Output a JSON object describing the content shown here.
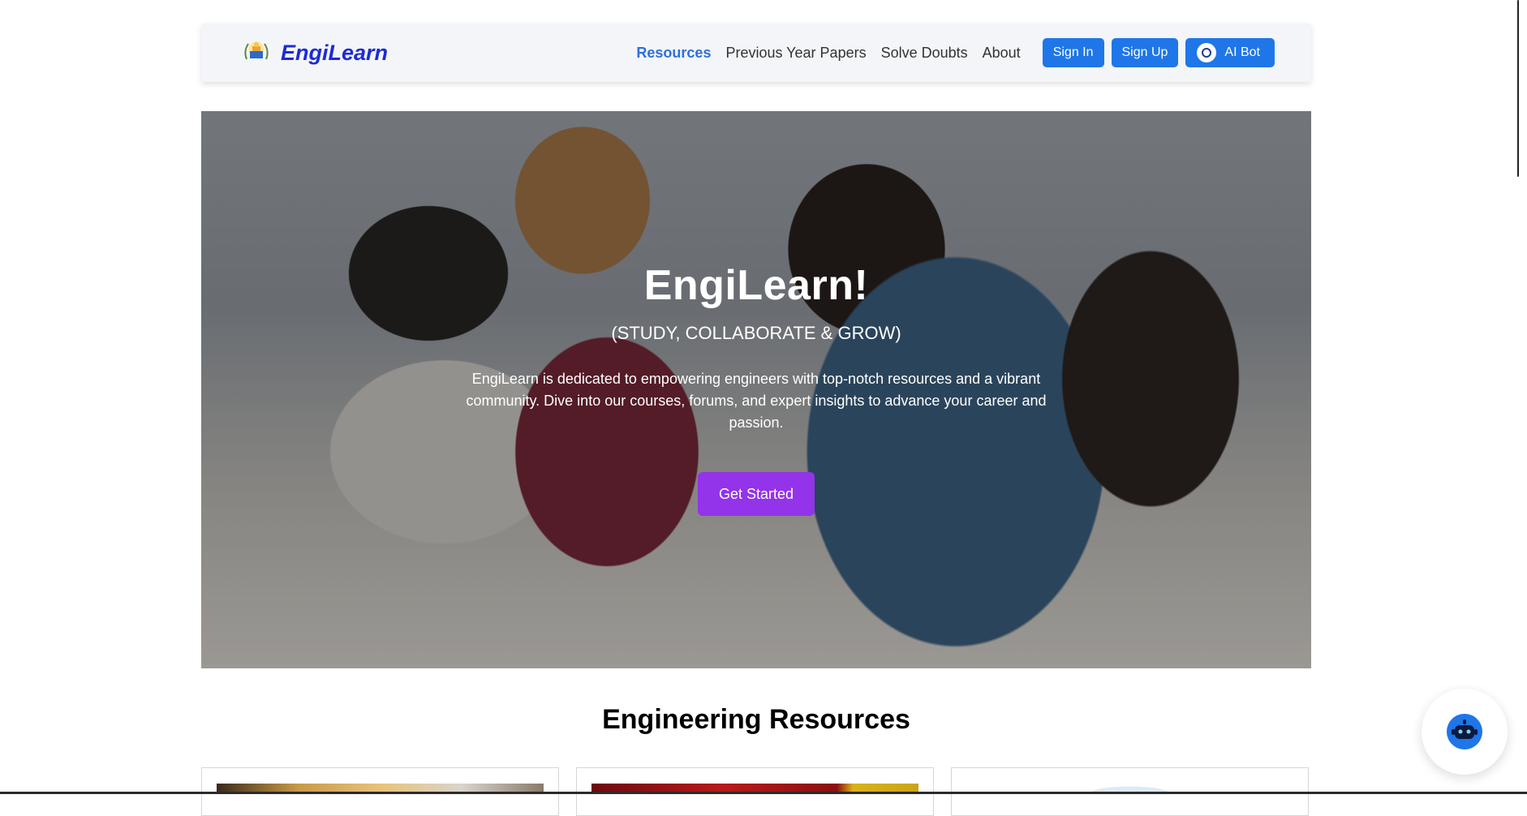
{
  "navbar": {
    "brand": "EngiLearn",
    "links": [
      "Resources",
      "Previous Year Papers",
      "Solve Doubts",
      "About"
    ],
    "active_link": "Resources",
    "sign_in": "Sign In",
    "sign_up": "Sign Up",
    "ai_bot": "AI Bot"
  },
  "hero": {
    "title": "EngiLearn!",
    "subtitle": "(STUDY, COLLABORATE & GROW)",
    "description": "EngiLearn is dedicated to empowering engineers with top-notch resources and a vibrant community. Dive into our courses, forums, and expert insights to advance your career and passion.",
    "cta": "Get Started"
  },
  "resources": {
    "title": "Engineering Resources"
  },
  "icons": {
    "logo": "engilearn-logo-icon",
    "ai_bot": "robot-icon",
    "chat_fab": "chatbot-icon"
  },
  "colors": {
    "brand": "#1d2bd6",
    "active_link": "#2f6fdc",
    "button_blue": "#1e76e8",
    "cta_purple": "#9333ea"
  }
}
